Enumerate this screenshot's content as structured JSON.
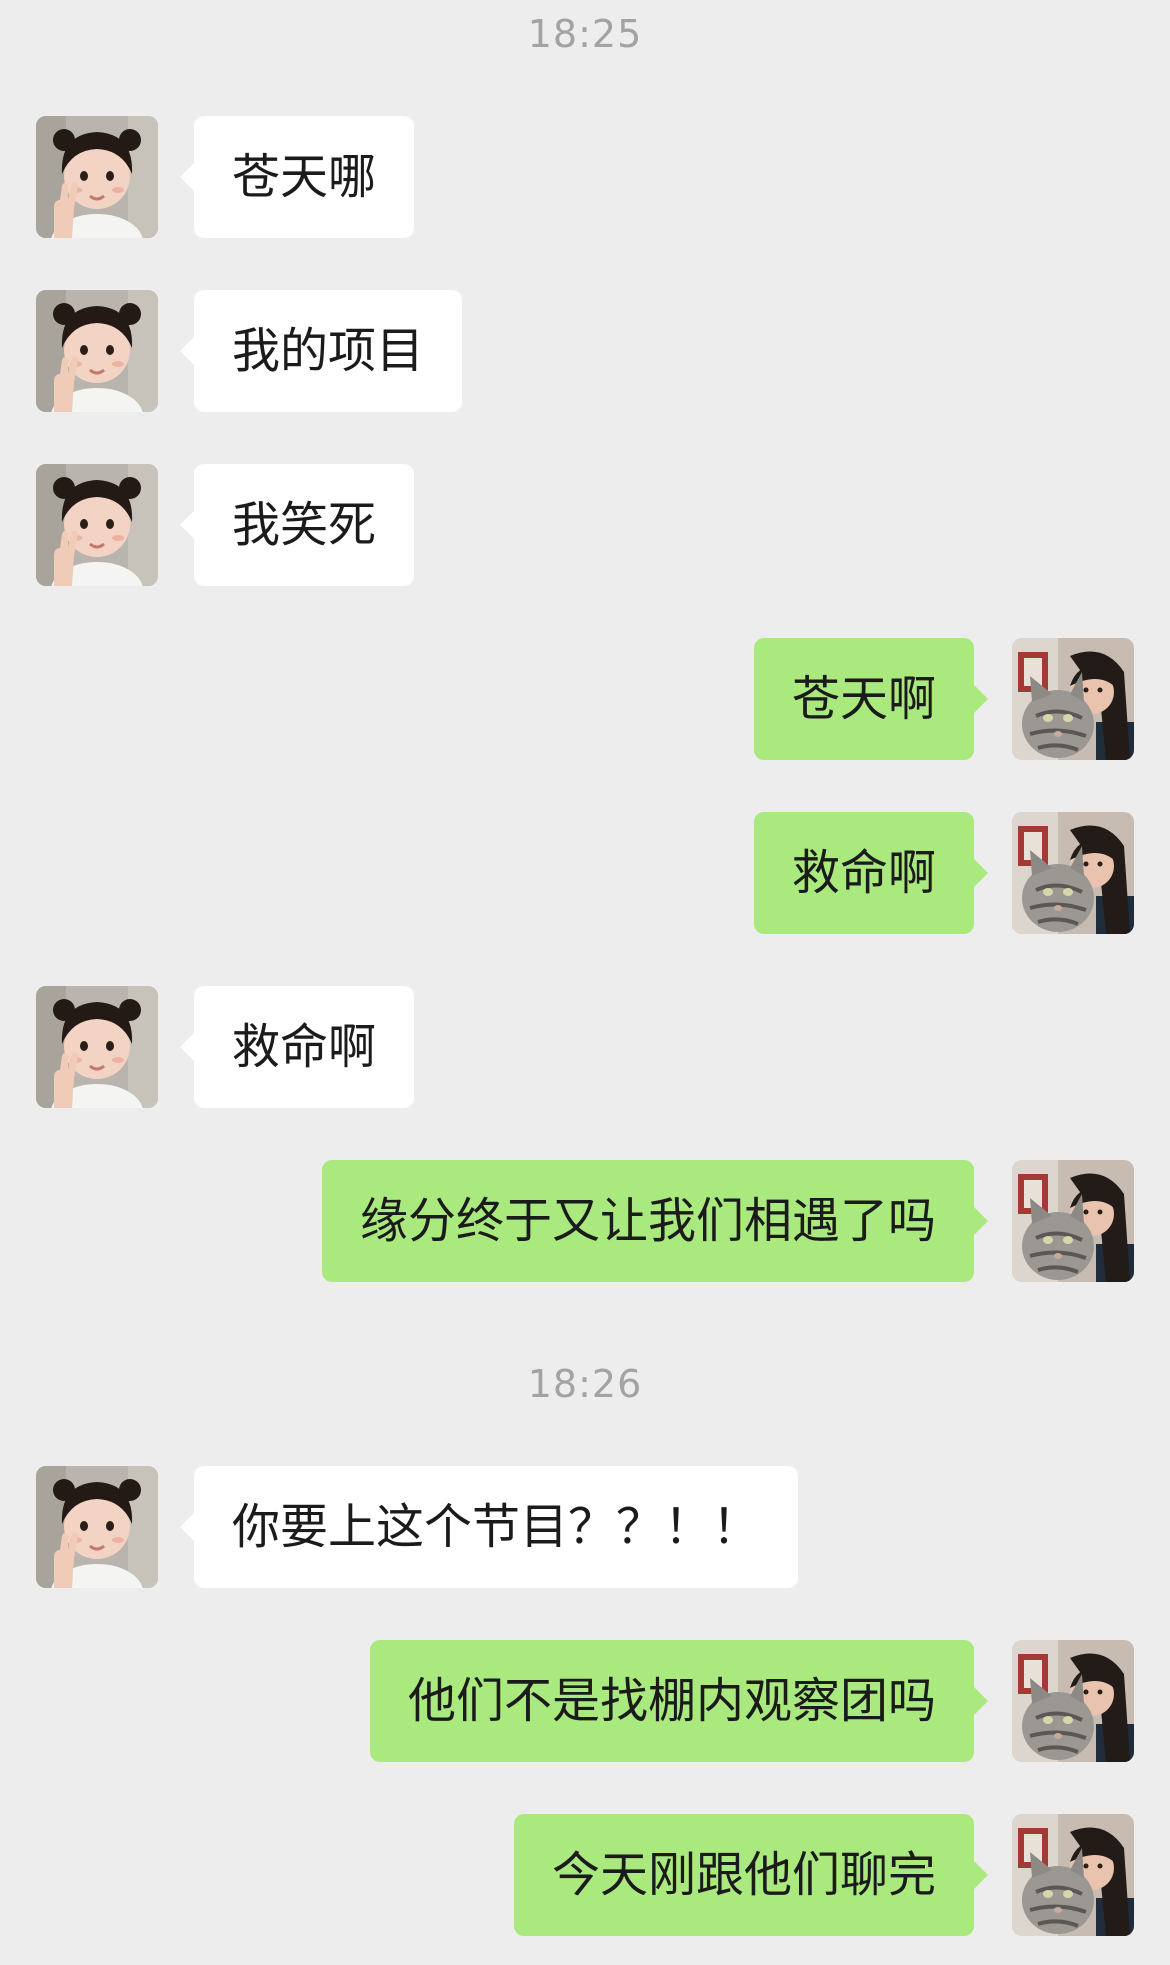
{
  "timestamps": [
    "18:25",
    "18:26"
  ],
  "contact": {
    "avatar_icon": "girl-peace-sign-avatar-icon"
  },
  "me": {
    "avatar_icon": "girl-with-cat-avatar-icon"
  },
  "colors": {
    "background": "#ededed",
    "received_bubble": "#ffffff",
    "sent_bubble": "#a9e97e",
    "timestamp_text": "#a3a3a3",
    "message_text": "#1b1b1b"
  },
  "messages": [
    {
      "side": "left",
      "text": "苍天哪"
    },
    {
      "side": "left",
      "text": "我的项目"
    },
    {
      "side": "left",
      "text": "我笑死"
    },
    {
      "side": "right",
      "text": "苍天啊"
    },
    {
      "side": "right",
      "text": "救命啊"
    },
    {
      "side": "left",
      "text": "救命啊"
    },
    {
      "side": "right",
      "text": "缘分终于又让我们相遇了吗"
    },
    {
      "side": "left",
      "text": "你要上这个节目？？！！"
    },
    {
      "side": "right",
      "text": "他们不是找棚内观察团吗"
    },
    {
      "side": "right",
      "text": "今天刚跟他们聊完"
    }
  ]
}
